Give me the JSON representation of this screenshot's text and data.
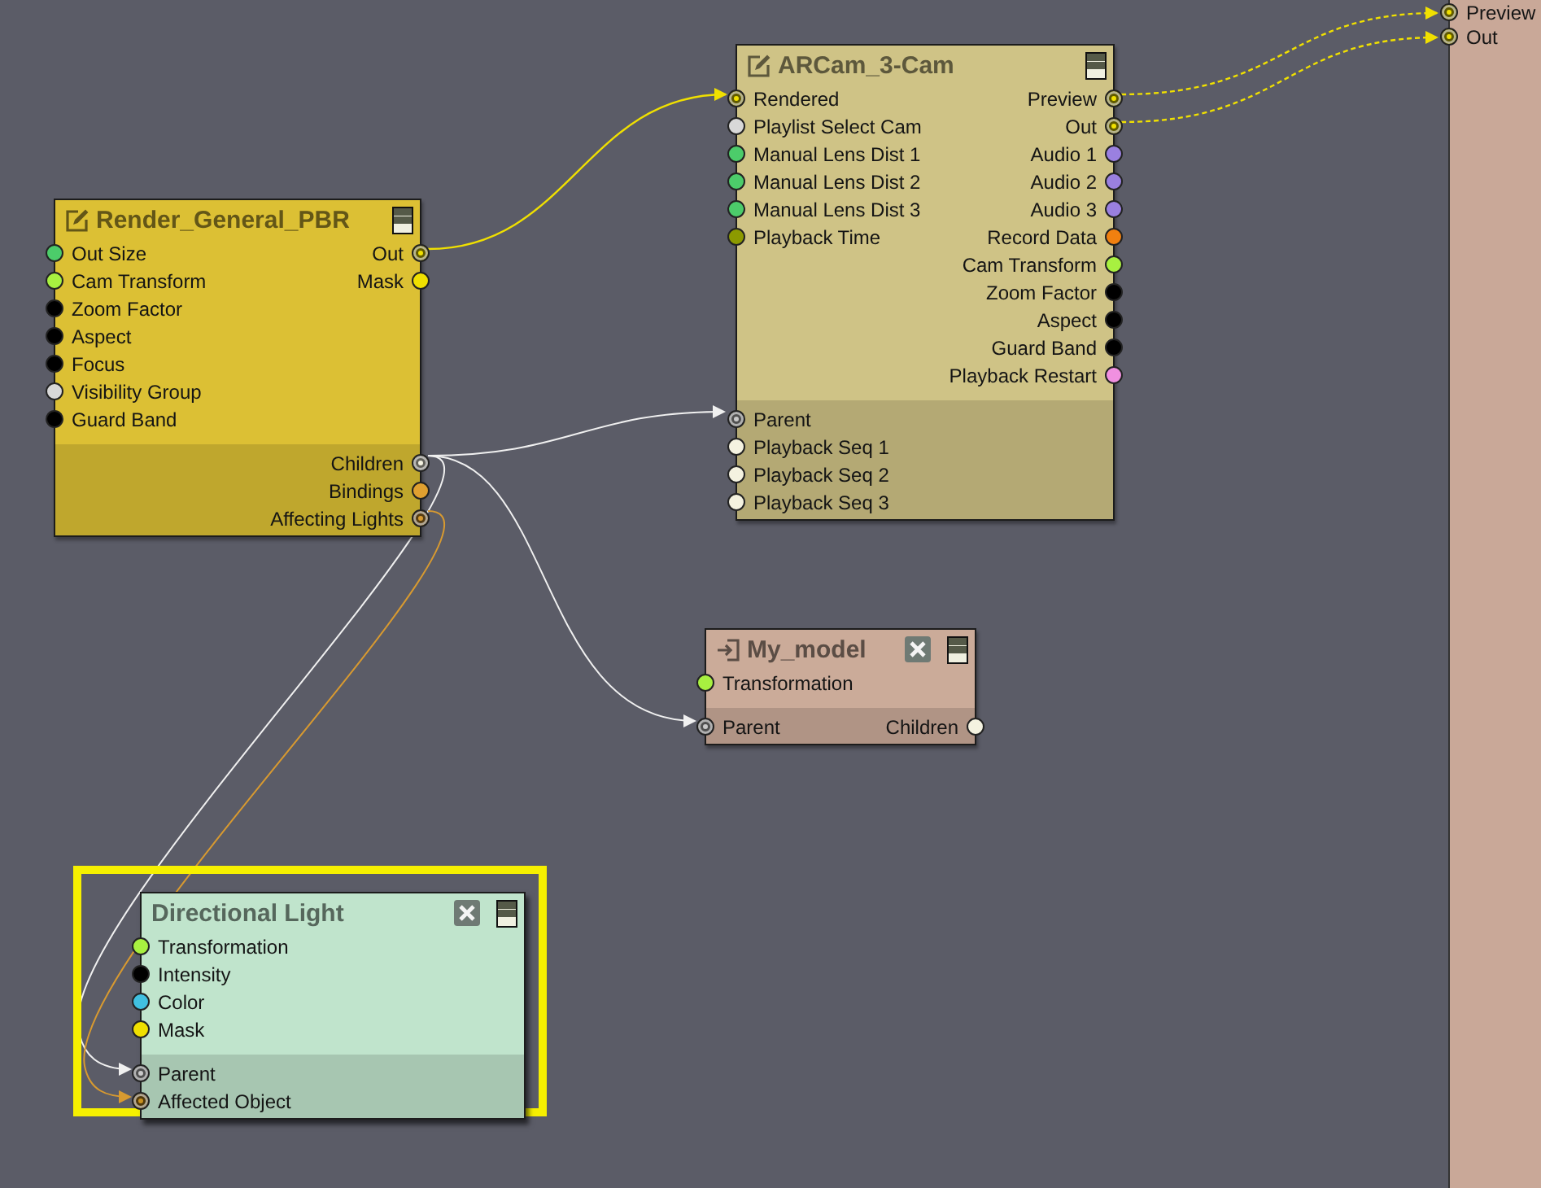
{
  "nodes": [
    {
      "title": "Render_General_PBR",
      "closable": false,
      "selected": false,
      "color": "#dcc034",
      "top": {
        "inputs": [
          {
            "label": "Out Size",
            "color": "#4ccc6a",
            "linked": false
          },
          {
            "label": "Cam Transform",
            "color": "#a8f040",
            "linked": false
          },
          {
            "label": "Zoom Factor",
            "color": "#000000",
            "linked": false
          },
          {
            "label": "Aspect",
            "color": "#000000",
            "linked": false
          },
          {
            "label": "Focus",
            "color": "#000000",
            "linked": false
          },
          {
            "label": "Visibility Group",
            "color": "#d8d8d8",
            "linked": false
          },
          {
            "label": "Guard Band",
            "color": "#000000",
            "linked": false
          }
        ],
        "outputs": [
          {
            "label": "Out",
            "color": "#f0e000",
            "linked": true
          },
          {
            "label": "Mask",
            "color": "#f0e000",
            "linked": false
          }
        ]
      },
      "bottom": {
        "outputs": [
          {
            "label": "Children",
            "color": "#f4f2e0",
            "linked": true
          },
          {
            "label": "Bindings",
            "color": "#e0a030",
            "linked": false
          },
          {
            "label": "Affecting Lights",
            "color": "#d89a30",
            "linked": true
          }
        ]
      }
    },
    {
      "title": "ARCam_3-Cam",
      "closable": false,
      "selected": false,
      "color": "#cfc386",
      "top": {
        "inputs": [
          {
            "label": "Rendered",
            "color": "#f0e000",
            "linked": true
          },
          {
            "label": "Playlist Select Cam",
            "color": "#d8d8d8",
            "linked": false
          },
          {
            "label": "Manual Lens Dist 1",
            "color": "#4ccc6a",
            "linked": false
          },
          {
            "label": "Manual Lens Dist 2",
            "color": "#4ccc6a",
            "linked": false
          },
          {
            "label": "Manual Lens Dist 3",
            "color": "#4ccc6a",
            "linked": false
          },
          {
            "label": "Playback Time",
            "color": "#8c9a00",
            "linked": false
          }
        ],
        "outputs": [
          {
            "label": "Preview",
            "color": "#f0e000",
            "linked": true
          },
          {
            "label": "Out",
            "color": "#f0e000",
            "linked": true
          },
          {
            "label": "Audio 1",
            "color": "#9a80e0",
            "linked": false
          },
          {
            "label": "Audio 2",
            "color": "#9a80e0",
            "linked": false
          },
          {
            "label": "Audio 3",
            "color": "#9a80e0",
            "linked": false
          },
          {
            "label": "Record Data",
            "color": "#f08010",
            "linked": false
          },
          {
            "label": "Cam Transform",
            "color": "#a8f040",
            "linked": false
          },
          {
            "label": "Zoom Factor",
            "color": "#000000",
            "linked": false
          },
          {
            "label": "Aspect",
            "color": "#000000",
            "linked": false
          },
          {
            "label": "Guard Band",
            "color": "#000000",
            "linked": false
          },
          {
            "label": "Playback Restart",
            "color": "#f090e0",
            "linked": false
          }
        ]
      },
      "bottom": {
        "inputs": [
          {
            "label": "Parent",
            "color": "#c8c8c8",
            "linked": true
          },
          {
            "label": "Playback Seq 1",
            "color": "#f4f2e0",
            "linked": false
          },
          {
            "label": "Playback Seq 2",
            "color": "#f4f2e0",
            "linked": false
          },
          {
            "label": "Playback Seq 3",
            "color": "#f4f2e0",
            "linked": false
          }
        ]
      }
    },
    {
      "title": "My_model",
      "closable": true,
      "selected": false,
      "color": "#cbab99",
      "top": {
        "inputs": [
          {
            "label": "Transformation",
            "color": "#a8f040",
            "linked": false
          }
        ]
      },
      "bottom": {
        "inputs": [
          {
            "label": "Parent",
            "color": "#c8c8c8",
            "linked": true
          }
        ],
        "outputs": [
          {
            "label": "Children",
            "color": "#f4f2e0",
            "linked": false
          }
        ]
      }
    },
    {
      "title": "Directional Light",
      "closable": true,
      "selected": true,
      "color": "#c0e4cc",
      "top": {
        "inputs": [
          {
            "label": "Transformation",
            "color": "#a8f040",
            "linked": false
          },
          {
            "label": "Intensity",
            "color": "#000000",
            "linked": false
          },
          {
            "label": "Color",
            "color": "#40c0e0",
            "linked": false
          },
          {
            "label": "Mask",
            "color": "#f0e000",
            "linked": false
          }
        ]
      },
      "bottom": {
        "inputs": [
          {
            "label": "Parent",
            "color": "#c8c8c8",
            "linked": true
          },
          {
            "label": "Affected Object",
            "color": "#c89020",
            "linked": true
          }
        ]
      }
    }
  ],
  "output_panel": {
    "ports": [
      {
        "label": "Preview",
        "color": "#f0e000",
        "linked": true
      },
      {
        "label": "Out",
        "color": "#f0e000",
        "linked": true
      }
    ]
  }
}
